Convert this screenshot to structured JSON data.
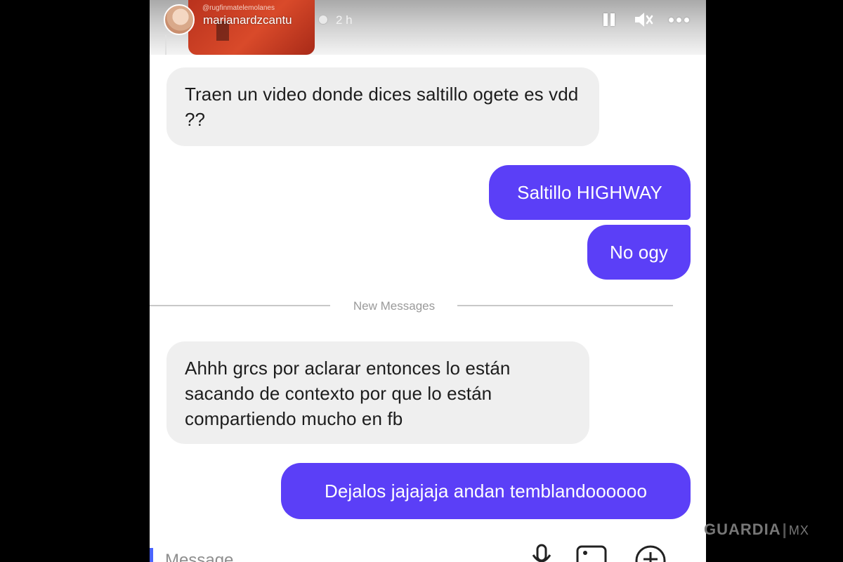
{
  "story": {
    "thumbnail_text": "@rugfinmatelemolanes",
    "username": "marianardzcantu",
    "time": "2 h"
  },
  "messages": [
    {
      "direction": "incoming",
      "text": "Traen un video donde dices saltillo ogete es vdd ??"
    },
    {
      "direction": "outgoing",
      "text": "Saltillo HIGHWAY"
    },
    {
      "direction": "outgoing",
      "text": "No ogy"
    },
    {
      "direction": "incoming",
      "text": "Ahhh grcs por aclarar entonces lo están sacando de contexto por que lo están compartiendo mucho en fb"
    },
    {
      "direction": "outgoing",
      "text": "Dejalos jajajaja andan temblandoooooo"
    }
  ],
  "divider": {
    "label": "New Messages"
  },
  "composer": {
    "placeholder": "Message",
    "icons": [
      "microphone-icon",
      "gallery-icon",
      "plus-circle-icon"
    ]
  },
  "watermark": {
    "brand": "GUARDIA",
    "country": "MX"
  },
  "colors": {
    "outgoing_bubble": "#5b3ff7",
    "incoming_bubble": "#efefef",
    "background": "#000000"
  }
}
